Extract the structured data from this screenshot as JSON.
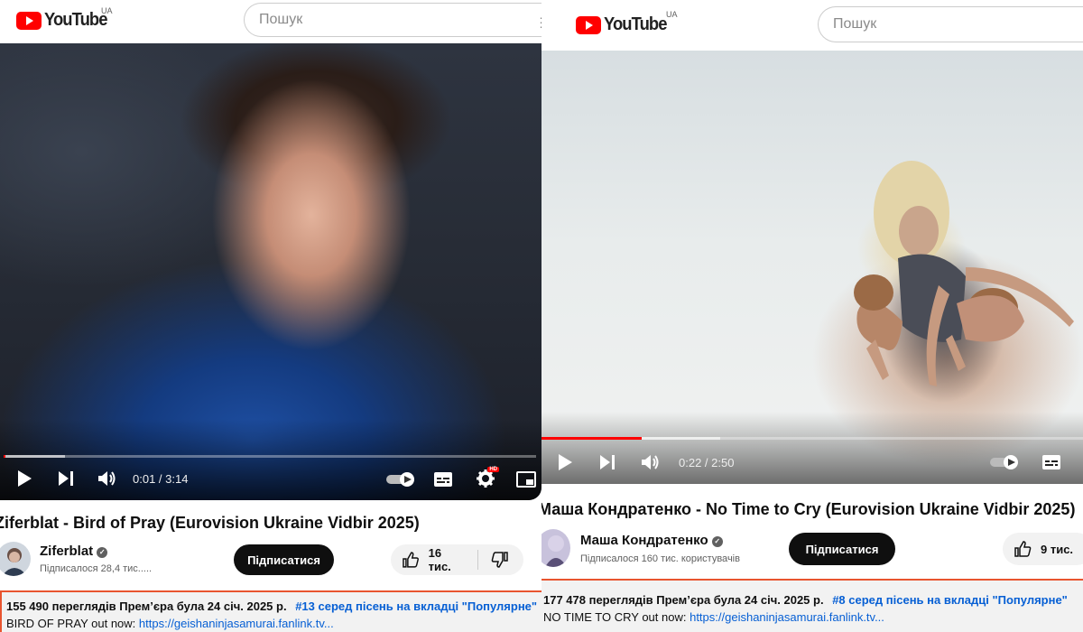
{
  "panels": [
    {
      "logo_text": "YouTube",
      "region": "UA",
      "search_placeholder": "Пошук",
      "menu_glyph": "☰",
      "player": {
        "progress_played": 0.003,
        "progress_buffered": 0.115,
        "time": "0:01 / 3:14",
        "hd_badge": "HD"
      },
      "title": "Ziferblat - Bird of Pray (Eurovision Ukraine Vidbir 2025)",
      "channel": {
        "name": "Ziferblat",
        "subscribers": "Підписалося 28,4 тис....."
      },
      "subscribe_label": "Підписатися",
      "likes": "16 тис.",
      "description": {
        "meta": "155 490 переглядів  Прем’єра була 24 січ. 2025 р.",
        "tag": "#13 серед пісень на вкладці \"Популярне\"",
        "line_prefix": "BIRD OF PRAY out now: ",
        "link": "https://geishaninjasamurai.fanlink.tv..."
      }
    },
    {
      "logo_text": "YouTube",
      "region": "UA",
      "search_placeholder": "Пошук",
      "player": {
        "progress_played": 0.185,
        "progress_buffered": 0.33,
        "time": "0:22 / 2:50"
      },
      "title": "Маша Кондратенко - No Time to Cry (Eurovision Ukraine Vidbir 2025)",
      "channel": {
        "name": "Маша Кондратенко",
        "subscribers": "Підписалося 160 тис. користувачів"
      },
      "subscribe_label": "Підписатися",
      "likes": "9 тис.",
      "description": {
        "meta": "177 478 переглядів  Прем’єра була 24 січ. 2025 р.",
        "tag": "#8 серед пісень на вкладці \"Популярне\"",
        "line_prefix": "NO TIME TO CRY out now: ",
        "link": "https://geishaninjasamurai.fanlink.tv..."
      }
    }
  ],
  "colors": {
    "accent_red": "#ff0000",
    "link_blue": "#065fd4",
    "description_border": "#e8542f"
  }
}
